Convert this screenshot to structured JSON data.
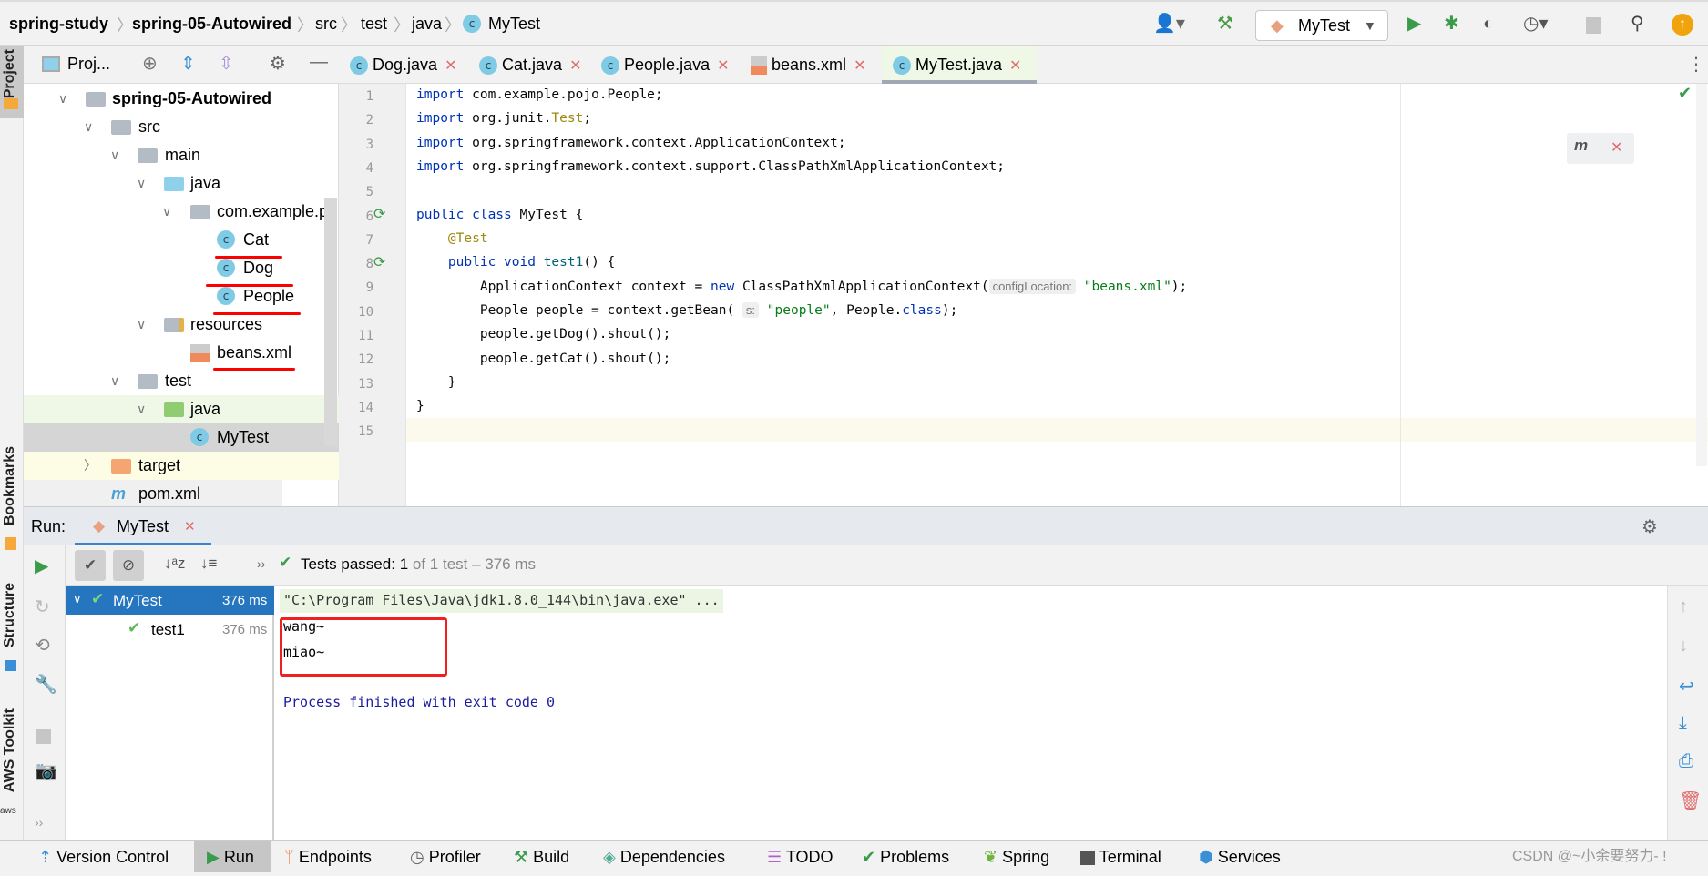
{
  "breadcrumb": [
    "spring-study",
    "spring-05-Autowired",
    "src",
    "test",
    "java",
    "MyTest"
  ],
  "toolbar": {
    "run_config": "MyTest",
    "icons": [
      "user-icon",
      "hammer-icon",
      "run-icon",
      "debug-icon",
      "coverage-icon",
      "profiler-icon",
      "stop-icon",
      "search-icon",
      "update-icon"
    ]
  },
  "side_strip": {
    "project": "Project",
    "bookmarks": "Bookmarks",
    "structure": "Structure",
    "aws": "AWS Toolkit"
  },
  "project_panel": {
    "title": "Proj...",
    "tree": [
      {
        "label": "spring-05-Autowired",
        "bold": true
      },
      {
        "label": "src"
      },
      {
        "label": "main"
      },
      {
        "label": "java"
      },
      {
        "label": "com.example.pc"
      },
      {
        "label": "Cat"
      },
      {
        "label": "Dog"
      },
      {
        "label": "People"
      },
      {
        "label": "resources"
      },
      {
        "label": "beans.xml"
      },
      {
        "label": "test"
      },
      {
        "label": "java"
      },
      {
        "label": "MyTest"
      },
      {
        "label": "target"
      },
      {
        "label": "pom.xml"
      }
    ]
  },
  "editor_tabs": [
    {
      "label": "Dog.java"
    },
    {
      "label": "Cat.java"
    },
    {
      "label": "People.java"
    },
    {
      "label": "beans.xml"
    },
    {
      "label": "MyTest.java",
      "active": true
    }
  ],
  "code": {
    "line_numbers": [
      "1",
      "2",
      "3",
      "4",
      "5",
      "6",
      "7",
      "8",
      "9",
      "10",
      "11",
      "12",
      "13",
      "14",
      "15"
    ],
    "hint_config": "configLocation:",
    "hint_s": "s:"
  },
  "run": {
    "label": "Run:",
    "tab": "MyTest",
    "status_prefix": "Tests passed:",
    "passed": "1",
    "status_suffix": "of 1 test – 376 ms",
    "tests": [
      {
        "name": "MyTest",
        "time": "376 ms"
      },
      {
        "name": "test1",
        "time": "376 ms"
      }
    ],
    "console": [
      "\"C:\\Program Files\\Java\\jdk1.8.0_144\\bin\\java.exe\" ...",
      "wang~",
      "miao~",
      "",
      "Process finished with exit code 0"
    ]
  },
  "bottom_tabs": [
    "Version Control",
    "Run",
    "Endpoints",
    "Profiler",
    "Build",
    "Dependencies",
    "TODO",
    "Problems",
    "Spring",
    "Terminal",
    "Services"
  ],
  "watermark": "CSDN @~小余要努力- !"
}
